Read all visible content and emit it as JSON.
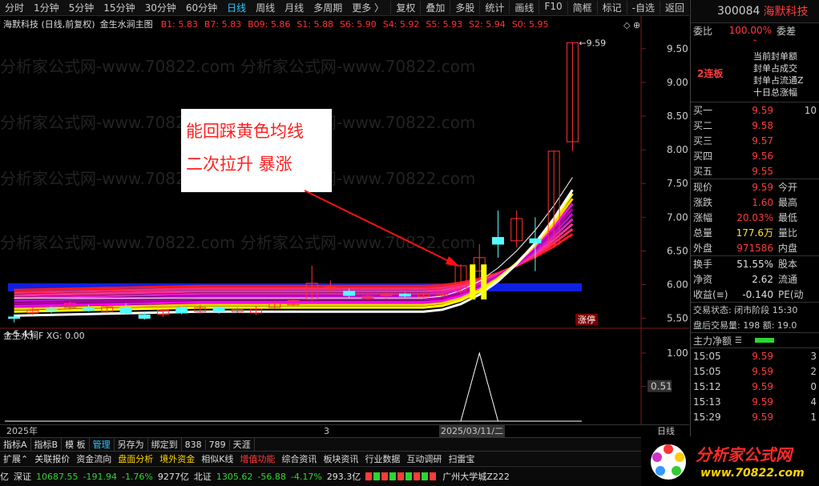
{
  "toolbar": {
    "periods": [
      "分时",
      "1分钟",
      "5分钟",
      "15分钟",
      "30分钟",
      "60分钟",
      "日线",
      "周线",
      "月线",
      "多周期",
      "更多 〉"
    ],
    "active_period": "日线",
    "actions": [
      "复权",
      "叠加",
      "多股",
      "统计",
      "画线",
      "F10",
      "简框",
      "标记",
      "-自选",
      "返回"
    ]
  },
  "chart_title": {
    "stock": "海默科技 (日线,前复权)",
    "indicator": "金生水涧主图",
    "ma_labels": [
      {
        "label": "B1: 5.83",
        "color": "#ff3333"
      },
      {
        "label": "B7: 5.83",
        "color": "#ff3333"
      },
      {
        "label": "B09: 5.86",
        "color": "#ff3333"
      },
      {
        "label": "S1: 5.88",
        "color": "#ff3333"
      },
      {
        "label": "S6: 5.90",
        "color": "#ff3333"
      },
      {
        "label": "S4: 5.92",
        "color": "#ff3333"
      },
      {
        "label": "S5: 5.93",
        "color": "#ff3333"
      },
      {
        "label": "S2: 5.94",
        "color": "#ff3333"
      },
      {
        "label": "S0: 5.95",
        "color": "#ff3333"
      }
    ]
  },
  "annotation": {
    "line1": "能回踩黄色均线",
    "line2": "二次拉升 暴涨"
  },
  "watermark": "分析家公式网-www.70822.com",
  "price_axis": {
    "ticks": [
      "9.50",
      "9.00",
      "8.50",
      "8.00",
      "7.50",
      "7.00",
      "6.50",
      "6.00",
      "5.50"
    ],
    "max_label": "9.59",
    "min_label": "5.44"
  },
  "limit_badge": "涨停",
  "indicator_panel": {
    "title": "金生水涧F  XG: 0.00",
    "ticks": [
      "1.00",
      "0.51"
    ]
  },
  "date_axis": {
    "left": "2025年",
    "mid": "3",
    "right": "2025/03/11/二",
    "period": "日线"
  },
  "tabs1": [
    "指标A",
    "指标B",
    "模 板",
    "管理",
    "另存为",
    "绑定到",
    "838",
    "789",
    "天涯"
  ],
  "tabs2": [
    "扩展⌃",
    "关联报价",
    "资金流向",
    "盘面分析",
    "境外资金",
    "相似K线",
    "增值功能",
    "综合资讯",
    "板块资讯",
    "行业数据",
    "互动调研",
    "扫雷宝",
    "图文F10"
  ],
  "status": {
    "sh": "亿",
    "sz_label": "深证",
    "sz_value": "10687.55",
    "sz_change": "-191.94",
    "sz_pct": "-1.76%",
    "sz_amount": "9277亿",
    "bz_label": "北证",
    "bz_value": "1305.62",
    "bz_change": "-56.88",
    "bz_pct": "-4.17%",
    "bz_amount": "293.3亿",
    "location": "广州大学城Z222"
  },
  "quote": {
    "code": "300084",
    "name": "海默科技",
    "weibi_label": "委比",
    "weibi_value": "100.00%",
    "weicha_label": "委差",
    "limit_info": [
      "当前封单额",
      "封单占成交",
      "封单占流通Z",
      "十日总涨幅"
    ],
    "board": "2连板",
    "buy": [
      {
        "label": "买一",
        "price": "9.59",
        "vol": "10"
      },
      {
        "label": "买二",
        "price": "9.58",
        "vol": ""
      },
      {
        "label": "买三",
        "price": "9.57",
        "vol": ""
      },
      {
        "label": "买四",
        "price": "9.56",
        "vol": ""
      },
      {
        "label": "买五",
        "price": "9.55",
        "vol": ""
      }
    ],
    "stats": [
      {
        "label": "现价",
        "value": "9.59",
        "extra": "今开"
      },
      {
        "label": "涨跌",
        "value": "1.60",
        "extra": "最高"
      },
      {
        "label": "涨幅",
        "value": "20.03%",
        "extra": "最低"
      },
      {
        "label": "总量",
        "value": "177.6万",
        "extra": "量比"
      },
      {
        "label": "外盘",
        "value": "971586",
        "extra": "内盘"
      }
    ],
    "stats2": [
      {
        "label": "换手",
        "value": "51.55%",
        "extra": "股本"
      },
      {
        "label": "净资",
        "value": "2.62",
        "extra": "流通"
      },
      {
        "label": "收益(≡)",
        "value": "-0.140",
        "extra": "PE(动"
      }
    ],
    "trade_state": "交易状态: 闭市阶段 15:30",
    "after_hours": "盘后交易量: 198  额: 19.0",
    "main_flow": "主力净额",
    "ticks": [
      {
        "time": "15:05",
        "price": "9.59",
        "vol": "3"
      },
      {
        "time": "15:05",
        "price": "9.59",
        "vol": "2"
      },
      {
        "time": "15:12",
        "price": "9.59",
        "vol": "0"
      },
      {
        "time": "15:13",
        "price": "9.59",
        "vol": "4"
      },
      {
        "time": "15:29",
        "price": "9.59",
        "vol": "1"
      }
    ]
  },
  "logo": {
    "text": "分析家公式网",
    "url": "www.70822.com"
  },
  "chart_data": {
    "type": "candlestick",
    "y_range": [
      5.4,
      9.7
    ],
    "candles": [
      {
        "o": 5.52,
        "c": 5.5,
        "h": 5.56,
        "l": 5.44
      },
      {
        "o": 5.58,
        "c": 5.62,
        "h": 5.66,
        "l": 5.55
      },
      {
        "o": 5.64,
        "c": 5.62,
        "h": 5.68,
        "l": 5.58
      },
      {
        "o": 5.66,
        "c": 5.72,
        "h": 5.75,
        "l": 5.63
      },
      {
        "o": 5.65,
        "c": 5.62,
        "h": 5.7,
        "l": 5.6
      },
      {
        "o": 5.6,
        "c": 5.67,
        "h": 5.7,
        "l": 5.58
      },
      {
        "o": 5.66,
        "c": 5.58,
        "h": 5.72,
        "l": 5.56
      },
      {
        "o": 5.55,
        "c": 5.5,
        "h": 5.6,
        "l": 5.48
      },
      {
        "o": 5.56,
        "c": 5.62,
        "h": 5.64,
        "l": 5.52
      },
      {
        "o": 5.66,
        "c": 5.58,
        "h": 5.68,
        "l": 5.56
      },
      {
        "o": 5.6,
        "c": 5.66,
        "h": 5.7,
        "l": 5.57
      },
      {
        "o": 5.66,
        "c": 5.6,
        "h": 5.68,
        "l": 5.57
      },
      {
        "o": 5.6,
        "c": 5.63,
        "h": 5.66,
        "l": 5.58
      },
      {
        "o": 5.58,
        "c": 5.64,
        "h": 5.68,
        "l": 5.55
      },
      {
        "o": 5.66,
        "c": 5.72,
        "h": 5.76,
        "l": 5.64
      },
      {
        "o": 5.7,
        "c": 5.76,
        "h": 5.8,
        "l": 5.68
      },
      {
        "o": 5.78,
        "c": 6.02,
        "h": 6.28,
        "l": 5.76
      },
      {
        "o": 5.95,
        "c": 5.96,
        "h": 6.06,
        "l": 5.88
      },
      {
        "o": 5.9,
        "c": 5.84,
        "h": 5.94,
        "l": 5.8
      },
      {
        "o": 5.8,
        "c": 5.83,
        "h": 5.86,
        "l": 5.78
      },
      {
        "o": 5.84,
        "c": 5.86,
        "h": 5.88,
        "l": 5.8
      },
      {
        "o": 5.86,
        "c": 5.83,
        "h": 5.88,
        "l": 5.8
      },
      {
        "o": 5.82,
        "c": 5.86,
        "h": 5.88,
        "l": 5.8
      },
      {
        "o": 5.84,
        "c": 5.86,
        "h": 5.9,
        "l": 5.82
      },
      {
        "o": 5.9,
        "c": 6.28,
        "h": 6.3,
        "l": 5.86
      },
      {
        "o": 6.2,
        "c": 6.4,
        "h": 6.6,
        "l": 6.1
      },
      {
        "o": 6.7,
        "c": 6.6,
        "h": 7.1,
        "l": 6.4
      },
      {
        "o": 6.65,
        "c": 6.98,
        "h": 7.1,
        "l": 6.55
      },
      {
        "o": 6.68,
        "c": 6.62,
        "h": 7.0,
        "l": 6.2
      },
      {
        "o": 6.6,
        "c": 7.98,
        "h": 7.98,
        "l": 6.55
      },
      {
        "o": 8.12,
        "c": 9.59,
        "h": 9.59,
        "l": 7.98
      }
    ],
    "signal": [
      0,
      0,
      0,
      0,
      0,
      0,
      0,
      0,
      0,
      0,
      0,
      0,
      0,
      0,
      0,
      0,
      0,
      0,
      0,
      0,
      0,
      0,
      0,
      0,
      0,
      1,
      0,
      0,
      0,
      0,
      0
    ],
    "indicator_range": [
      0,
      1.2
    ]
  }
}
